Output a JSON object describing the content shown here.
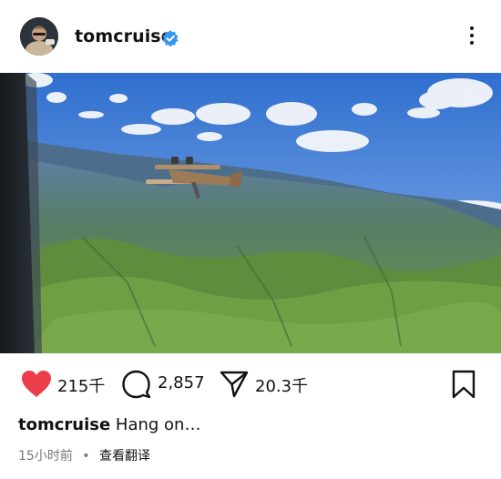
{
  "post": {
    "username": "tomcruise",
    "caption_username": "tomcruise",
    "caption_text": "Hang on…",
    "timestamp": "15小时前",
    "separator": "•",
    "translate_label": "查看翻译"
  },
  "actions": {
    "likes": "215千",
    "comments": "2,857",
    "shares": "20.3千"
  },
  "icons": {
    "avatar": "avatar",
    "verified": "verified-badge-icon",
    "more": "more-options-icon",
    "like": "heart-icon",
    "comment": "comment-bubble-icon",
    "share": "paper-plane-icon",
    "save": "bookmark-icon",
    "mute": "muted-speaker-icon"
  },
  "colors": {
    "like": "#ec3e4a",
    "verified": "#3897f0",
    "sky": "#4f86d2",
    "mountains": "#5a7f4a"
  }
}
